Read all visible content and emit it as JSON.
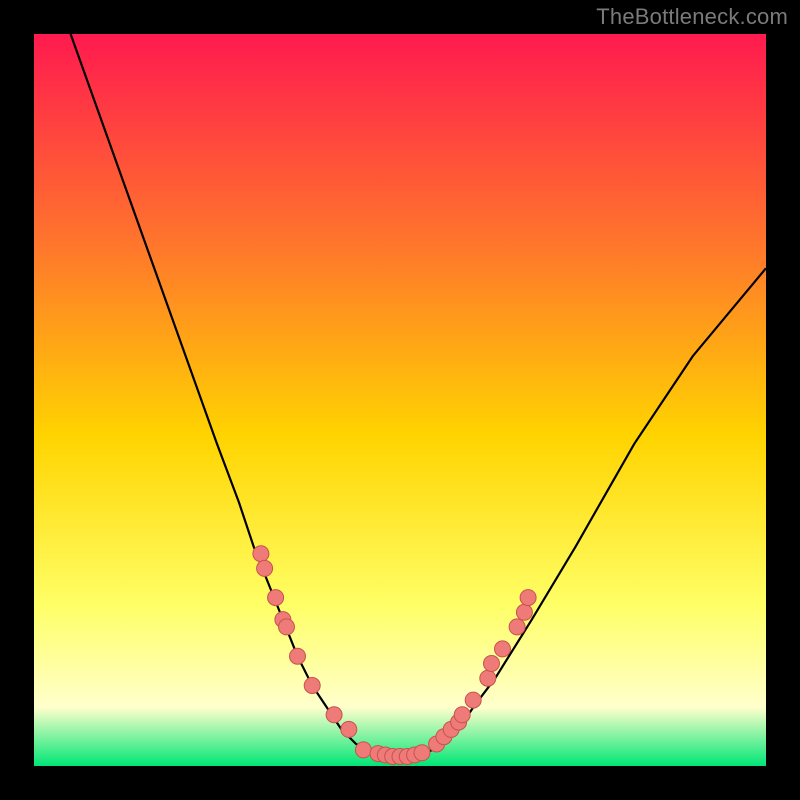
{
  "watermark": "TheBottleneck.com",
  "colors": {
    "frame": "#000000",
    "grad_top": "#ff1a4f",
    "grad_mid1": "#ff7a2a",
    "grad_mid2": "#ffd400",
    "grad_low": "#ffff66",
    "grad_pale": "#ffffcc",
    "grad_bottom": "#00e676",
    "curve": "#000000",
    "marker": "#ee7b78",
    "marker_stroke": "#c8524d"
  },
  "chart_data": {
    "type": "line",
    "title": "",
    "xlabel": "",
    "ylabel": "",
    "xlim": [
      0,
      100
    ],
    "ylim": [
      0,
      100
    ],
    "curve": {
      "left_x": [
        5,
        10,
        15,
        20,
        25,
        28,
        30,
        32,
        34,
        36,
        38,
        40,
        42,
        44,
        46
      ],
      "left_y": [
        100,
        86,
        72,
        58,
        44,
        36,
        30,
        25,
        20,
        15,
        11,
        8,
        5,
        3,
        2
      ],
      "bottom_x": [
        46,
        48,
        50,
        52,
        54,
        56
      ],
      "bottom_y": [
        2,
        1.3,
        1.1,
        1.3,
        2,
        3
      ],
      "right_x": [
        56,
        58,
        60,
        63,
        68,
        74,
        82,
        90,
        100
      ],
      "right_y": [
        3,
        5,
        8,
        12,
        20,
        30,
        44,
        56,
        68
      ]
    },
    "markers_left": [
      {
        "x": 31,
        "y": 29
      },
      {
        "x": 31.5,
        "y": 27
      },
      {
        "x": 33,
        "y": 23
      },
      {
        "x": 34,
        "y": 20
      },
      {
        "x": 34.5,
        "y": 19
      },
      {
        "x": 36,
        "y": 15
      },
      {
        "x": 38,
        "y": 11
      },
      {
        "x": 41,
        "y": 7
      },
      {
        "x": 43,
        "y": 5
      }
    ],
    "markers_right": [
      {
        "x": 55,
        "y": 3
      },
      {
        "x": 56,
        "y": 4
      },
      {
        "x": 57,
        "y": 5
      },
      {
        "x": 58,
        "y": 6
      },
      {
        "x": 58.5,
        "y": 7
      },
      {
        "x": 60,
        "y": 9
      },
      {
        "x": 62,
        "y": 12
      },
      {
        "x": 62.5,
        "y": 14
      },
      {
        "x": 64,
        "y": 16
      },
      {
        "x": 66,
        "y": 19
      },
      {
        "x": 67,
        "y": 21
      },
      {
        "x": 67.5,
        "y": 23
      }
    ],
    "markers_bottom": [
      {
        "x": 45,
        "y": 2.2
      },
      {
        "x": 47,
        "y": 1.7
      },
      {
        "x": 48,
        "y": 1.5
      },
      {
        "x": 49,
        "y": 1.3
      },
      {
        "x": 50,
        "y": 1.3
      },
      {
        "x": 51,
        "y": 1.3
      },
      {
        "x": 52,
        "y": 1.5
      },
      {
        "x": 53,
        "y": 1.8
      }
    ]
  }
}
